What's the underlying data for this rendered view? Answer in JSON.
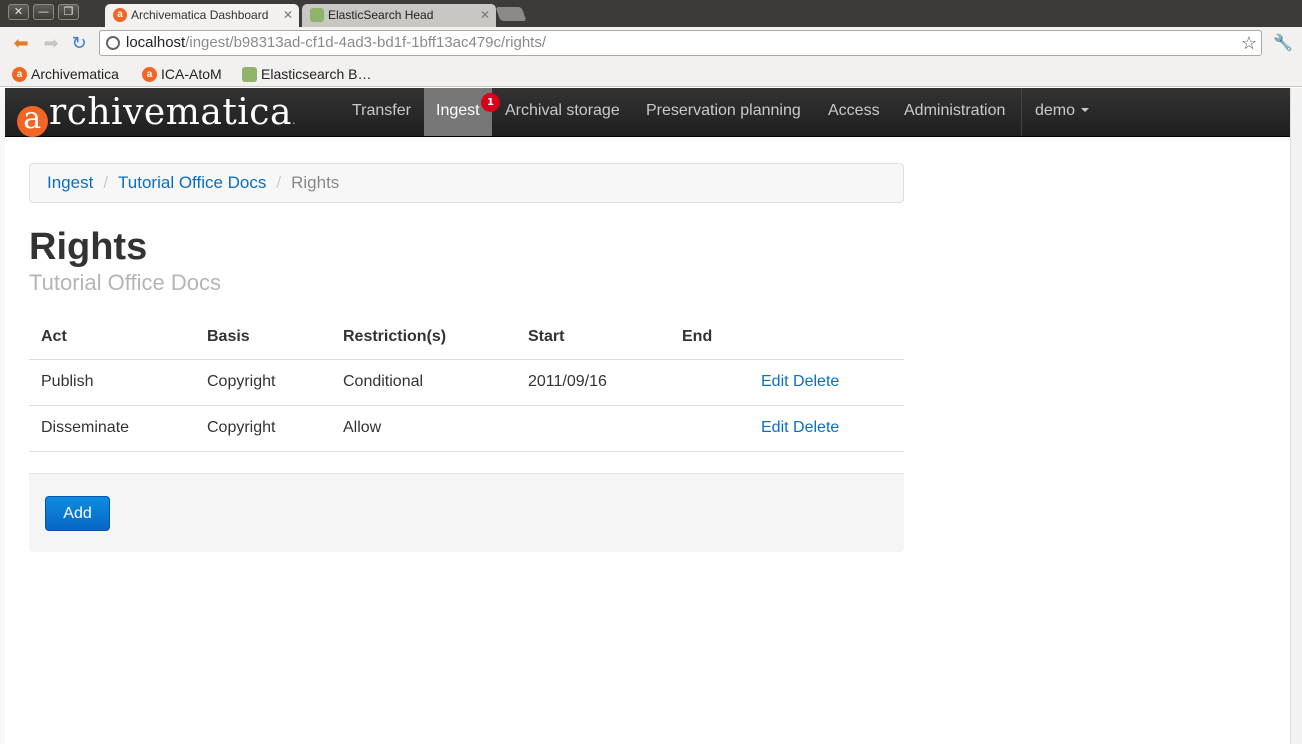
{
  "browser": {
    "tabs": [
      {
        "title": "Archivematica Dashboard",
        "favicon": "a"
      },
      {
        "title": "ElasticSearch Head",
        "favicon": ""
      }
    ],
    "url_host": "localhost",
    "url_path": "/ingest/b98313ad-cf1d-4ad3-bd1f-1bff13ac479c/rights/",
    "bookmarks": [
      {
        "label": "Archivematica",
        "favicon": "a"
      },
      {
        "label": "ICA-AtoM",
        "favicon": "a"
      },
      {
        "label": "Elasticsearch B…",
        "favicon": ""
      }
    ]
  },
  "navbar": {
    "brand_initial": "a",
    "brand_rest": "rchivematica",
    "brand_mark": ".",
    "items": [
      {
        "label": "Transfer"
      },
      {
        "label": "Ingest",
        "badge": "1"
      },
      {
        "label": "Archival storage"
      },
      {
        "label": "Preservation planning"
      },
      {
        "label": "Access"
      },
      {
        "label": "Administration"
      }
    ],
    "user": "demo"
  },
  "breadcrumb": {
    "items": [
      "Ingest",
      "Tutorial Office Docs",
      "Rights"
    ]
  },
  "page": {
    "title": "Rights",
    "subtitle": "Tutorial Office Docs"
  },
  "table": {
    "headers": [
      "Act",
      "Basis",
      "Restriction(s)",
      "Start",
      "End",
      ""
    ],
    "rows": [
      {
        "act": "Publish",
        "basis": "Copyright",
        "restriction": "Conditional",
        "start": "2011/09/16",
        "end": "",
        "edit": "Edit",
        "delete": "Delete"
      },
      {
        "act": "Disseminate",
        "basis": "Copyright",
        "restriction": "Allow",
        "start": "",
        "end": "",
        "edit": "Edit",
        "delete": "Delete"
      }
    ]
  },
  "actions": {
    "add_label": "Add"
  },
  "colors": {
    "accent": "#f26522",
    "link": "#0a6fc2",
    "navbar": "#222222",
    "badge": "#d9001b",
    "button": "#0866c6"
  }
}
